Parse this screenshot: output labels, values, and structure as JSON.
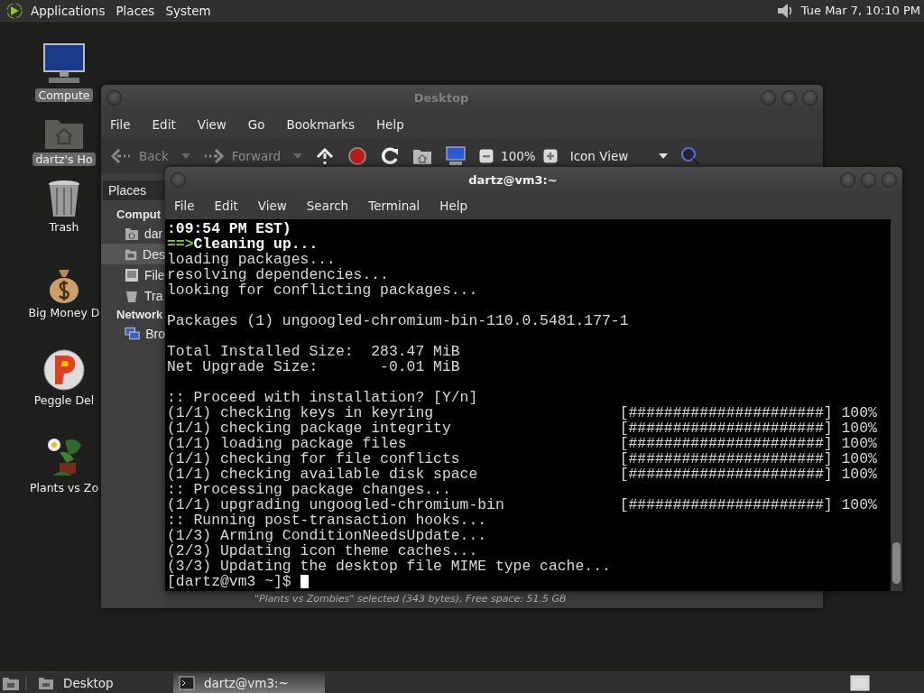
{
  "top_panel": {
    "menus": [
      "Applications",
      "Places",
      "System"
    ],
    "clock": "Tue Mar  7, 10:10 PM"
  },
  "desktop_icons": [
    {
      "kind": "computer",
      "label": "Compute",
      "selected": true
    },
    {
      "kind": "home",
      "label": "dartz's Ho",
      "selected": true
    },
    {
      "kind": "trash",
      "label": "Trash",
      "selected": false
    },
    {
      "kind": "money",
      "label": "Big Money D",
      "selected": false
    },
    {
      "kind": "peggle",
      "label": "Peggle Del",
      "selected": false
    },
    {
      "kind": "plants",
      "label": "Plants vs Zo",
      "selected": false
    }
  ],
  "file_manager": {
    "title": "Desktop",
    "menu": [
      "File",
      "Edit",
      "View",
      "Go",
      "Bookmarks",
      "Help"
    ],
    "toolbar": {
      "back": "Back",
      "forward": "Forward",
      "zoom": "100%",
      "view": "Icon View"
    },
    "sidebar": {
      "header": "Places",
      "sections": [
        {
          "title": "Comput",
          "items": [
            {
              "kind": "home",
              "label": "dar",
              "selected": false
            },
            {
              "kind": "desktop",
              "label": "Des",
              "selected": true
            },
            {
              "kind": "drive",
              "label": "File",
              "selected": false
            },
            {
              "kind": "trash",
              "label": "Tra",
              "selected": false
            }
          ]
        },
        {
          "title": "Network",
          "items": [
            {
              "kind": "network",
              "label": "Bro",
              "selected": false
            }
          ]
        }
      ]
    },
    "status": "\"Plants vs Zombies\" selected (343 bytes), Free space: 51.5 GB"
  },
  "terminal": {
    "title": "dartz@vm3:~",
    "menu": [
      "File",
      "Edit",
      "View",
      "Search",
      "Terminal",
      "Help"
    ],
    "lines": [
      {
        "kind": "bold",
        "text": ":09:54 PM EST)"
      },
      {
        "kind": "header",
        "arrow": "==>",
        "text": "Cleaning up..."
      },
      {
        "kind": "plain",
        "text": "loading packages..."
      },
      {
        "kind": "plain",
        "text": "resolving dependencies..."
      },
      {
        "kind": "plain",
        "text": "looking for conflicting packages..."
      },
      {
        "kind": "gap"
      },
      {
        "kind": "plain",
        "text": "Packages (1) ungoogled-chromium-bin-110.0.5481.177-1"
      },
      {
        "kind": "gap"
      },
      {
        "kind": "plain",
        "text": "Total Installed Size:  283.47 MiB"
      },
      {
        "kind": "plain",
        "text": "Net Upgrade Size:       -0.01 MiB"
      },
      {
        "kind": "gap"
      },
      {
        "kind": "plain",
        "text": ":: Proceed with installation? [Y/n]"
      },
      {
        "kind": "progress",
        "text": "(1/1) checking keys in keyring",
        "bar": "[######################]",
        "percent": "100%"
      },
      {
        "kind": "progress",
        "text": "(1/1) checking package integrity",
        "bar": "[######################]",
        "percent": "100%"
      },
      {
        "kind": "progress",
        "text": "(1/1) loading package files",
        "bar": "[######################]",
        "percent": "100%"
      },
      {
        "kind": "progress",
        "text": "(1/1) checking for file conflicts",
        "bar": "[######################]",
        "percent": "100%"
      },
      {
        "kind": "progress",
        "text": "(1/1) checking available disk space",
        "bar": "[######################]",
        "percent": "100%"
      },
      {
        "kind": "plain",
        "text": ":: Processing package changes..."
      },
      {
        "kind": "progress",
        "text": "(1/1) upgrading ungoogled-chromium-bin",
        "bar": "[######################]",
        "percent": "100%"
      },
      {
        "kind": "plain",
        "text": ":: Running post-transaction hooks..."
      },
      {
        "kind": "plain",
        "text": "(1/3) Arming ConditionNeedsUpdate..."
      },
      {
        "kind": "plain",
        "text": "(2/3) Updating icon theme caches..."
      },
      {
        "kind": "plain",
        "text": "(3/3) Updating the desktop file MIME type cache..."
      },
      {
        "kind": "prompt",
        "text": "[dartz@vm3 ~]$"
      }
    ]
  },
  "taskbar": {
    "items": [
      {
        "kind": "folder",
        "label": "Desktop",
        "selected": false
      },
      {
        "kind": "terminal",
        "label": "dartz@vm3:~",
        "selected": true
      }
    ]
  }
}
